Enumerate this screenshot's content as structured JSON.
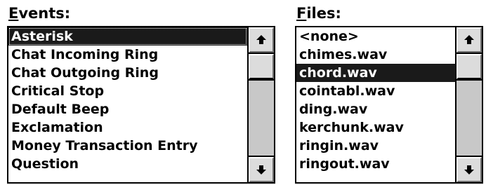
{
  "events": {
    "label_mnemonic": "E",
    "label_rest": "vents:",
    "items": [
      "Asterisk",
      "Chat Incoming Ring",
      "Chat Outgoing Ring",
      "Critical Stop",
      "Default Beep",
      "Exclamation",
      "Money Transaction Entry",
      "Question"
    ],
    "selected_index": 0
  },
  "files": {
    "label_mnemonic": "F",
    "label_rest": "iles:",
    "items": [
      "<none>",
      "chimes.wav",
      "chord.wav",
      "cointabl.wav",
      "ding.wav",
      "kerchunk.wav",
      "ringin.wav",
      "ringout.wav"
    ],
    "selected_index": 2
  },
  "icons": {
    "scroll_up": "arrow-up-icon",
    "scroll_down": "arrow-down-icon"
  },
  "colors": {
    "selection_bg": "#1a1a1a",
    "selection_fg": "#ffffff",
    "scrollbar_track": "#c8c8c8",
    "scrollbar_button": "#dcdcdc"
  }
}
